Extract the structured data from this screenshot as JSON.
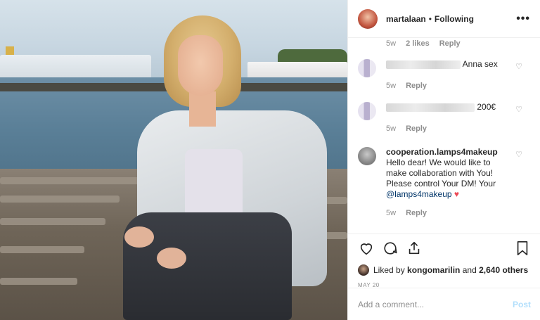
{
  "post": {
    "username": "martalaan",
    "separator": "•",
    "follow_status": "Following",
    "more_icon": "more-options-icon"
  },
  "comments": {
    "first_meta": {
      "age": "5w",
      "likes": "2 likes",
      "reply": "Reply"
    },
    "items": [
      {
        "user_hidden": true,
        "text": "Anna sex",
        "age": "5w",
        "reply": "Reply"
      },
      {
        "user_hidden": true,
        "text": "200€",
        "age": "5w",
        "reply": "Reply"
      },
      {
        "user": "cooperation.lamps4makeup",
        "text": "Hello dear! We would like to make collaboration with You! Please control Your DM! Your",
        "mention": "@lamps4makeup",
        "emoji": "♥",
        "age": "5w",
        "reply": "Reply"
      }
    ]
  },
  "actions": {
    "icons": [
      "heart-icon",
      "comment-icon",
      "share-icon",
      "bookmark-icon"
    ],
    "liked_by_prefix": "Liked by",
    "liked_by_user": "kongomarilin",
    "liked_by_and": "and",
    "liked_by_others": "2,640 others",
    "date": "MAY 20"
  },
  "add_comment": {
    "placeholder": "Add a comment...",
    "post_label": "Post"
  },
  "colors": {
    "accent_blue": "#0095f6",
    "post_disabled": "#b2dffc",
    "muted": "#8e8e8e",
    "heart_red": "#ed4956"
  }
}
